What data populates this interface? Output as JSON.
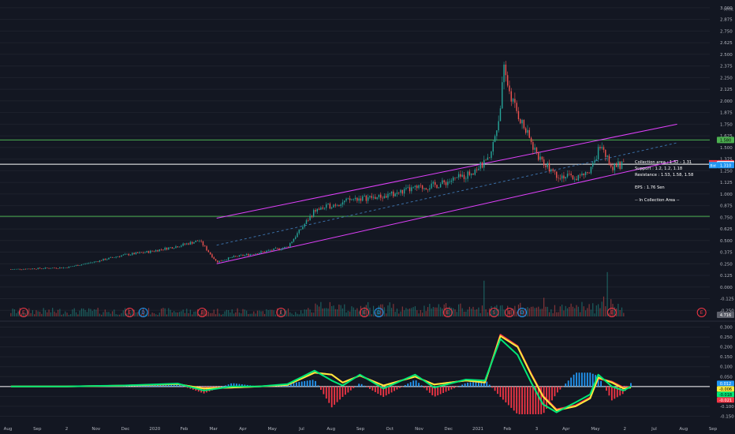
{
  "chart_data": [
    {
      "type": "candlestick",
      "title": "",
      "price_axis": {
        "unit_label": "MYR",
        "ticks": [
          3.0,
          2.875,
          2.75,
          2.625,
          2.5,
          2.375,
          2.25,
          2.125,
          2.0,
          1.875,
          1.75,
          1.625,
          1.5,
          1.375,
          1.25,
          1.125,
          1.0,
          0.875,
          0.75,
          0.625,
          0.5,
          0.375,
          0.25,
          0.125,
          0.0,
          -0.125,
          -0.25
        ],
        "ylim": [
          -0.29,
          3.05
        ]
      },
      "time_axis": {
        "labels": [
          "Aug",
          "Sep",
          "2",
          "Nov",
          "Dec",
          "2020",
          "Feb",
          "Mar",
          "Apr",
          "May",
          "Jul",
          "Aug",
          "Sep",
          "Oct",
          "Nov",
          "Dec",
          "2021",
          "Feb",
          "3",
          "Apr",
          "May",
          "2",
          "Jul",
          "Aug",
          "Sep"
        ]
      },
      "trend_points": [
        [
          "2019-08-01",
          0.19
        ],
        [
          "2019-09-01",
          0.2
        ],
        [
          "2019-10-01",
          0.21
        ],
        [
          "2019-11-01",
          0.27
        ],
        [
          "2019-12-01",
          0.34
        ],
        [
          "2020-01-01",
          0.38
        ],
        [
          "2020-02-01",
          0.44
        ],
        [
          "2020-02-25",
          0.5
        ],
        [
          "2020-03-15",
          0.27
        ],
        [
          "2020-04-01",
          0.32
        ],
        [
          "2020-05-01",
          0.37
        ],
        [
          "2020-06-01",
          0.43
        ],
        [
          "2020-07-01",
          0.82
        ],
        [
          "2020-07-20",
          0.88
        ],
        [
          "2020-08-15",
          0.95
        ],
        [
          "2020-09-15",
          0.97
        ],
        [
          "2020-10-15",
          1.05
        ],
        [
          "2020-11-15",
          1.1
        ],
        [
          "2020-12-15",
          1.2
        ],
        [
          "2021-01-10",
          1.36
        ],
        [
          "2021-01-20",
          1.8
        ],
        [
          "2021-01-26",
          2.32
        ],
        [
          "2021-02-05",
          1.98
        ],
        [
          "2021-02-20",
          1.65
        ],
        [
          "2021-03-05",
          1.4
        ],
        [
          "2021-03-25",
          1.21
        ],
        [
          "2021-04-15",
          1.17
        ],
        [
          "2021-05-01",
          1.23
        ],
        [
          "2021-05-12",
          1.52
        ],
        [
          "2021-05-25",
          1.3
        ],
        [
          "2021-06-07",
          1.31
        ]
      ],
      "horizontal_levels": [
        {
          "value": 1.58,
          "color": "#4caf50",
          "label": "1.580"
        },
        {
          "value": 1.32,
          "color": "#ffffff",
          "label": "1.320"
        },
        {
          "value": 0.76,
          "color": "#4caf50"
        }
      ],
      "price_tags": [
        {
          "value": 1.58,
          "text": "1.580",
          "bg": "#4caf50",
          "fg": "#000000"
        },
        {
          "value": 1.325,
          "text": "1.325",
          "bg": "#ffeb3b",
          "fg": "#000000"
        },
        {
          "value": 1.33,
          "text": "1.330",
          "bg": "#f23645",
          "fg": "#ffffff",
          "side": "Ask"
        },
        {
          "value": 1.32,
          "text": "1.320",
          "bg": "#ffffff",
          "fg": "#000000"
        },
        {
          "value": 1.31,
          "text": "1.310",
          "bg": "#2196f3",
          "fg": "#ffffff",
          "side": "Bid"
        }
      ],
      "channel": {
        "color": "#e040fb",
        "upper": [
          [
            "2020-03-15",
            0.74
          ],
          [
            "2021-08-05",
            1.75
          ]
        ],
        "lower": [
          [
            "2020-03-15",
            0.25
          ],
          [
            "2021-08-05",
            1.36
          ]
        ],
        "mid": [
          [
            "2020-03-15",
            0.45
          ],
          [
            "2021-08-05",
            1.55
          ]
        ]
      },
      "annotation": {
        "lines": [
          "Collection area : 1.32 - 1.31",
          "Support : 1.2, 1.2, 1.18",
          "Resistance : 1.53, 1.58, 1.58",
          "",
          "EPS : 1.76 Sen",
          "",
          "-- In Collection Area --"
        ]
      },
      "earnings_markers": [
        {
          "date": "2019-08-15",
          "text": "E",
          "color": "#f23645"
        },
        {
          "date": "2019-12-10",
          "text": "E",
          "color": "#f23645"
        },
        {
          "date": "2019-12-25",
          "text": "D",
          "color": "#2196f3"
        },
        {
          "date": "2020-02-28",
          "text": "E",
          "color": "#f23645"
        },
        {
          "date": "2020-05-25",
          "text": "E",
          "color": "#f23645"
        },
        {
          "date": "2020-08-25",
          "text": "E",
          "color": "#f23645"
        },
        {
          "date": "2020-09-10",
          "text": "D",
          "color": "#2196f3"
        },
        {
          "date": "2020-11-25",
          "text": "E",
          "color": "#f23645"
        },
        {
          "date": "2021-01-15",
          "text": "S",
          "color": "#f23645"
        },
        {
          "date": "2021-02-01",
          "text": "E",
          "color": "#f23645"
        },
        {
          "date": "2021-02-15",
          "text": "D",
          "color": "#2196f3"
        },
        {
          "date": "2021-05-25",
          "text": "E",
          "color": "#f23645"
        },
        {
          "date": "2021-09-01",
          "text": "E",
          "color": "#f23645"
        }
      ],
      "volume_tag": "4.716"
    },
    {
      "type": "line",
      "title": "",
      "axis": {
        "ticks": [
          0.3,
          0.25,
          0.2,
          0.15,
          0.1,
          0.05,
          0.0,
          -0.05,
          -0.1,
          -0.15
        ],
        "ylim": [
          -0.16,
          0.31
        ]
      },
      "series": [
        {
          "color": "#00e676",
          "points": [
            [
              "2019-08-01",
              0.0
            ],
            [
              "2019-10-01",
              0.0
            ],
            [
              "2019-12-01",
              0.005
            ],
            [
              "2020-02-01",
              0.015
            ],
            [
              "2020-03-01",
              -0.02
            ],
            [
              "2020-04-01",
              0.0
            ],
            [
              "2020-05-01",
              0.0
            ],
            [
              "2020-06-01",
              0.012
            ],
            [
              "2020-07-01",
              0.08
            ],
            [
              "2020-07-20",
              0.03
            ],
            [
              "2020-08-01",
              0.005
            ],
            [
              "2020-08-20",
              0.06
            ],
            [
              "2020-09-15",
              -0.01
            ],
            [
              "2020-10-20",
              0.06
            ],
            [
              "2020-11-10",
              -0.005
            ],
            [
              "2020-12-15",
              0.035
            ],
            [
              "2021-01-05",
              0.03
            ],
            [
              "2021-01-22",
              0.24
            ],
            [
              "2021-02-10",
              0.16
            ],
            [
              "2021-02-25",
              0.02
            ],
            [
              "2021-03-10",
              -0.09
            ],
            [
              "2021-03-25",
              -0.13
            ],
            [
              "2021-04-15",
              -0.08
            ],
            [
              "2021-05-01",
              -0.04
            ],
            [
              "2021-05-10",
              0.06
            ],
            [
              "2021-05-25",
              0.0
            ],
            [
              "2021-06-07",
              -0.02
            ],
            [
              "2021-06-15",
              0.0
            ]
          ]
        },
        {
          "color": "#ffeb3b",
          "points": [
            [
              "2019-08-01",
              0.0
            ],
            [
              "2019-10-01",
              0.0
            ],
            [
              "2019-12-01",
              0.004
            ],
            [
              "2020-02-01",
              0.012
            ],
            [
              "2020-03-01",
              -0.01
            ],
            [
              "2020-04-01",
              -0.005
            ],
            [
              "2020-05-01",
              0.0
            ],
            [
              "2020-06-01",
              0.008
            ],
            [
              "2020-07-01",
              0.07
            ],
            [
              "2020-07-20",
              0.06
            ],
            [
              "2020-08-01",
              0.02
            ],
            [
              "2020-08-20",
              0.055
            ],
            [
              "2020-09-15",
              0.005
            ],
            [
              "2020-10-20",
              0.05
            ],
            [
              "2020-11-10",
              0.01
            ],
            [
              "2020-12-15",
              0.03
            ],
            [
              "2021-01-05",
              0.02
            ],
            [
              "2021-01-22",
              0.255
            ],
            [
              "2021-02-10",
              0.2
            ],
            [
              "2021-02-25",
              0.06
            ],
            [
              "2021-03-10",
              -0.05
            ],
            [
              "2021-03-25",
              -0.12
            ],
            [
              "2021-04-15",
              -0.1
            ],
            [
              "2021-05-01",
              -0.06
            ],
            [
              "2021-05-10",
              0.045
            ],
            [
              "2021-05-25",
              0.02
            ],
            [
              "2021-06-07",
              -0.01
            ],
            [
              "2021-06-15",
              -0.005
            ]
          ]
        },
        {
          "color": "#f23645",
          "points": [
            [
              "2019-08-01",
              0.0
            ],
            [
              "2019-10-01",
              0.0
            ],
            [
              "2019-12-01",
              0.004
            ],
            [
              "2020-02-01",
              0.012
            ],
            [
              "2020-03-01",
              -0.01
            ],
            [
              "2020-04-01",
              -0.005
            ],
            [
              "2020-05-01",
              0.0
            ],
            [
              "2020-06-01",
              0.008
            ],
            [
              "2020-07-01",
              0.07
            ],
            [
              "2020-07-20",
              0.06
            ],
            [
              "2020-08-01",
              0.02
            ],
            [
              "2020-08-20",
              0.055
            ],
            [
              "2020-09-15",
              0.005
            ],
            [
              "2020-10-20",
              0.05
            ],
            [
              "2020-11-10",
              0.01
            ],
            [
              "2020-12-15",
              0.03
            ],
            [
              "2021-01-05",
              0.02
            ],
            [
              "2021-01-22",
              0.262
            ],
            [
              "2021-02-10",
              0.205
            ],
            [
              "2021-02-25",
              0.065
            ],
            [
              "2021-03-10",
              -0.045
            ],
            [
              "2021-03-25",
              -0.115
            ],
            [
              "2021-04-15",
              -0.095
            ],
            [
              "2021-05-01",
              -0.055
            ],
            [
              "2021-05-10",
              0.04
            ],
            [
              "2021-05-25",
              0.025
            ],
            [
              "2021-06-07",
              -0.005
            ],
            [
              "2021-06-15",
              -0.002
            ]
          ]
        }
      ],
      "value_tags": [
        {
          "text": "0.012",
          "bg": "#2196f3",
          "fg": "#ffffff",
          "value": 0.012
        },
        {
          "text": "-0.006",
          "bg": "#ffeb3b",
          "fg": "#000000",
          "value": -0.006
        },
        {
          "text": "-0.018",
          "bg": "#00e676",
          "fg": "#000000",
          "value": -0.018
        },
        {
          "text": "-0.021",
          "bg": "#f23645",
          "fg": "#ffffff",
          "value": -0.021
        }
      ]
    }
  ]
}
